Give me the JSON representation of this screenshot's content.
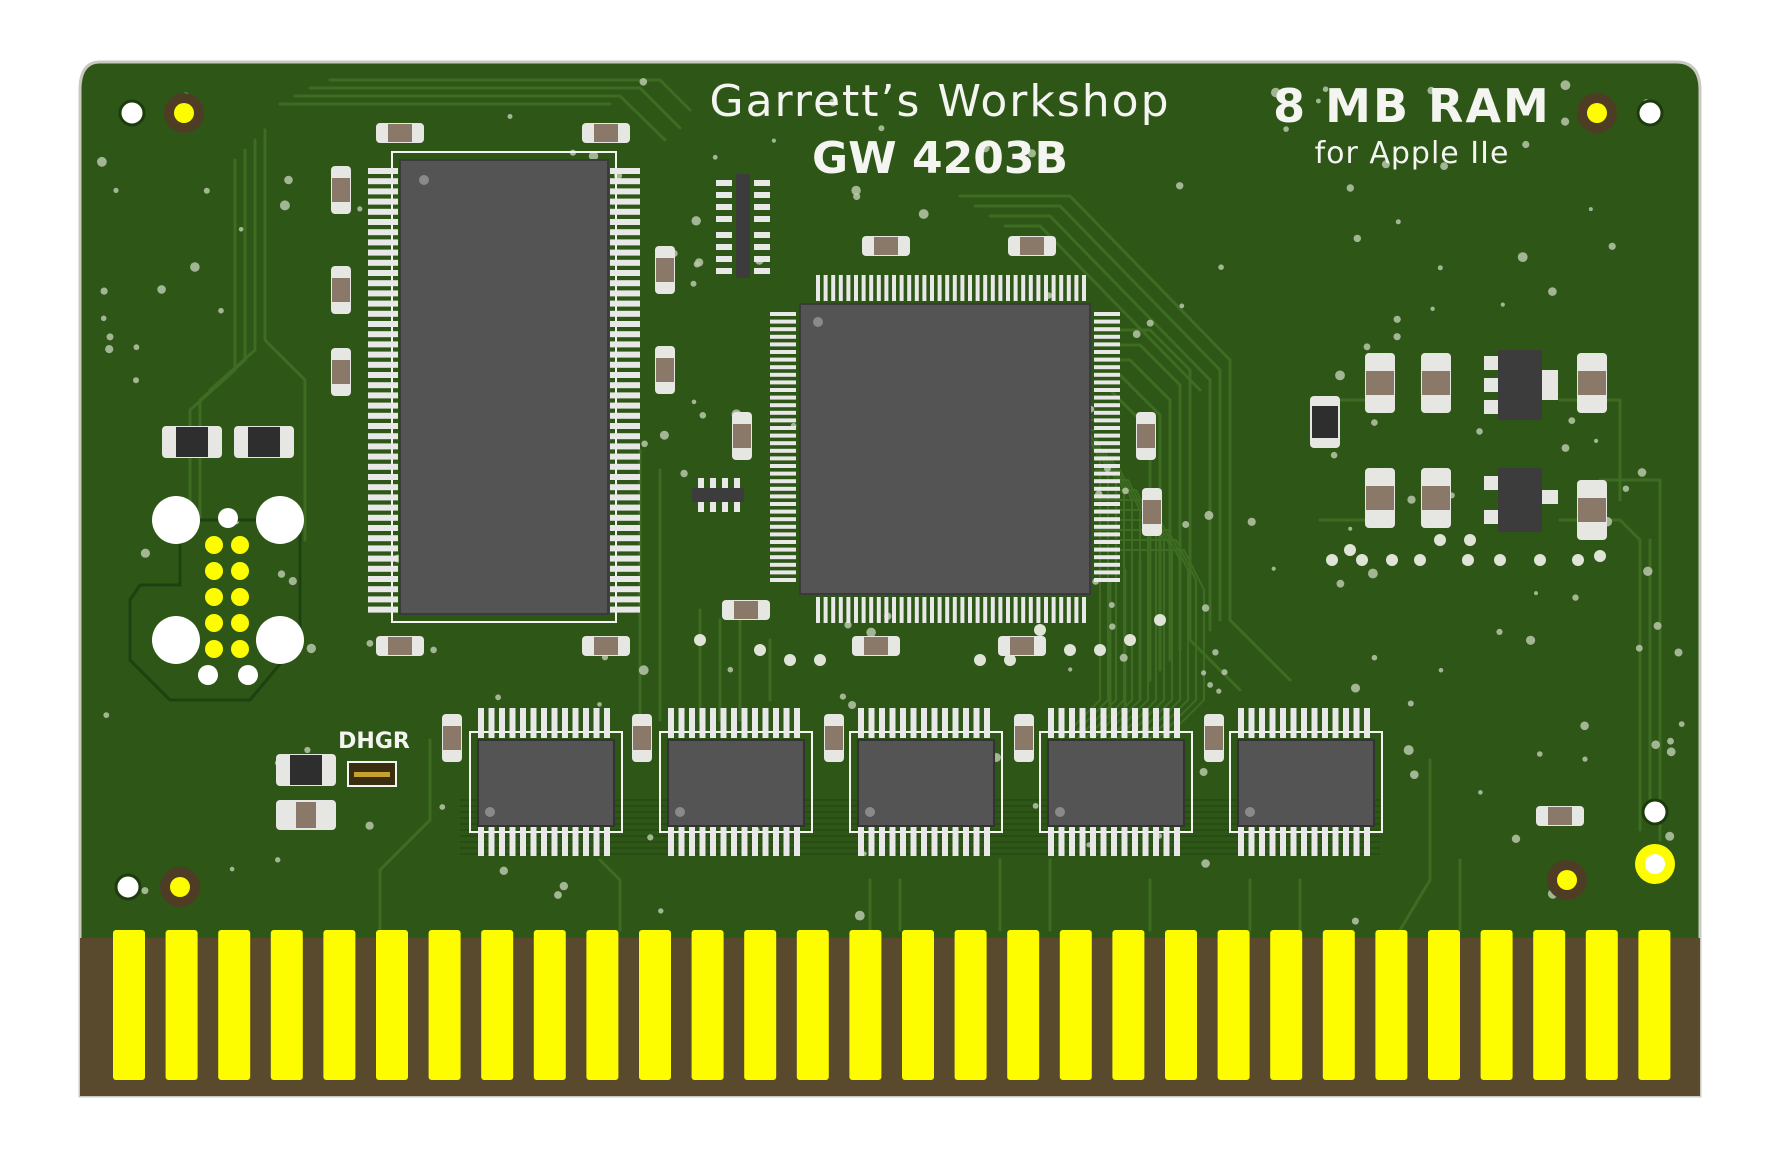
{
  "board": {
    "colors": {
      "solder_mask": "#2d5617",
      "solder_mask_trace": "#3e6c22",
      "solder_mask_dark": "#244812",
      "gold_pad": "#fdfd00",
      "edge_band": "#5a4a2d",
      "chip_body": "#545454",
      "chip_pin": "#e8e8e8",
      "silkscreen": "#f4f4f0",
      "smd_pad": "#e6e6e2",
      "smd_body": "#8a7868"
    },
    "silkscreen": {
      "maker": "Garrett’s Workshop",
      "part_number": "GW 4203B",
      "capacity": "8 MB RAM",
      "target": "for Apple IIe",
      "jumper_label": "DHGR"
    },
    "edge_connector": {
      "finger_count": 30
    },
    "components": {
      "large_sram": "tsop-chip",
      "cpld": "qfp-chip",
      "ram_chips": 5,
      "regulators": 2
    }
  }
}
